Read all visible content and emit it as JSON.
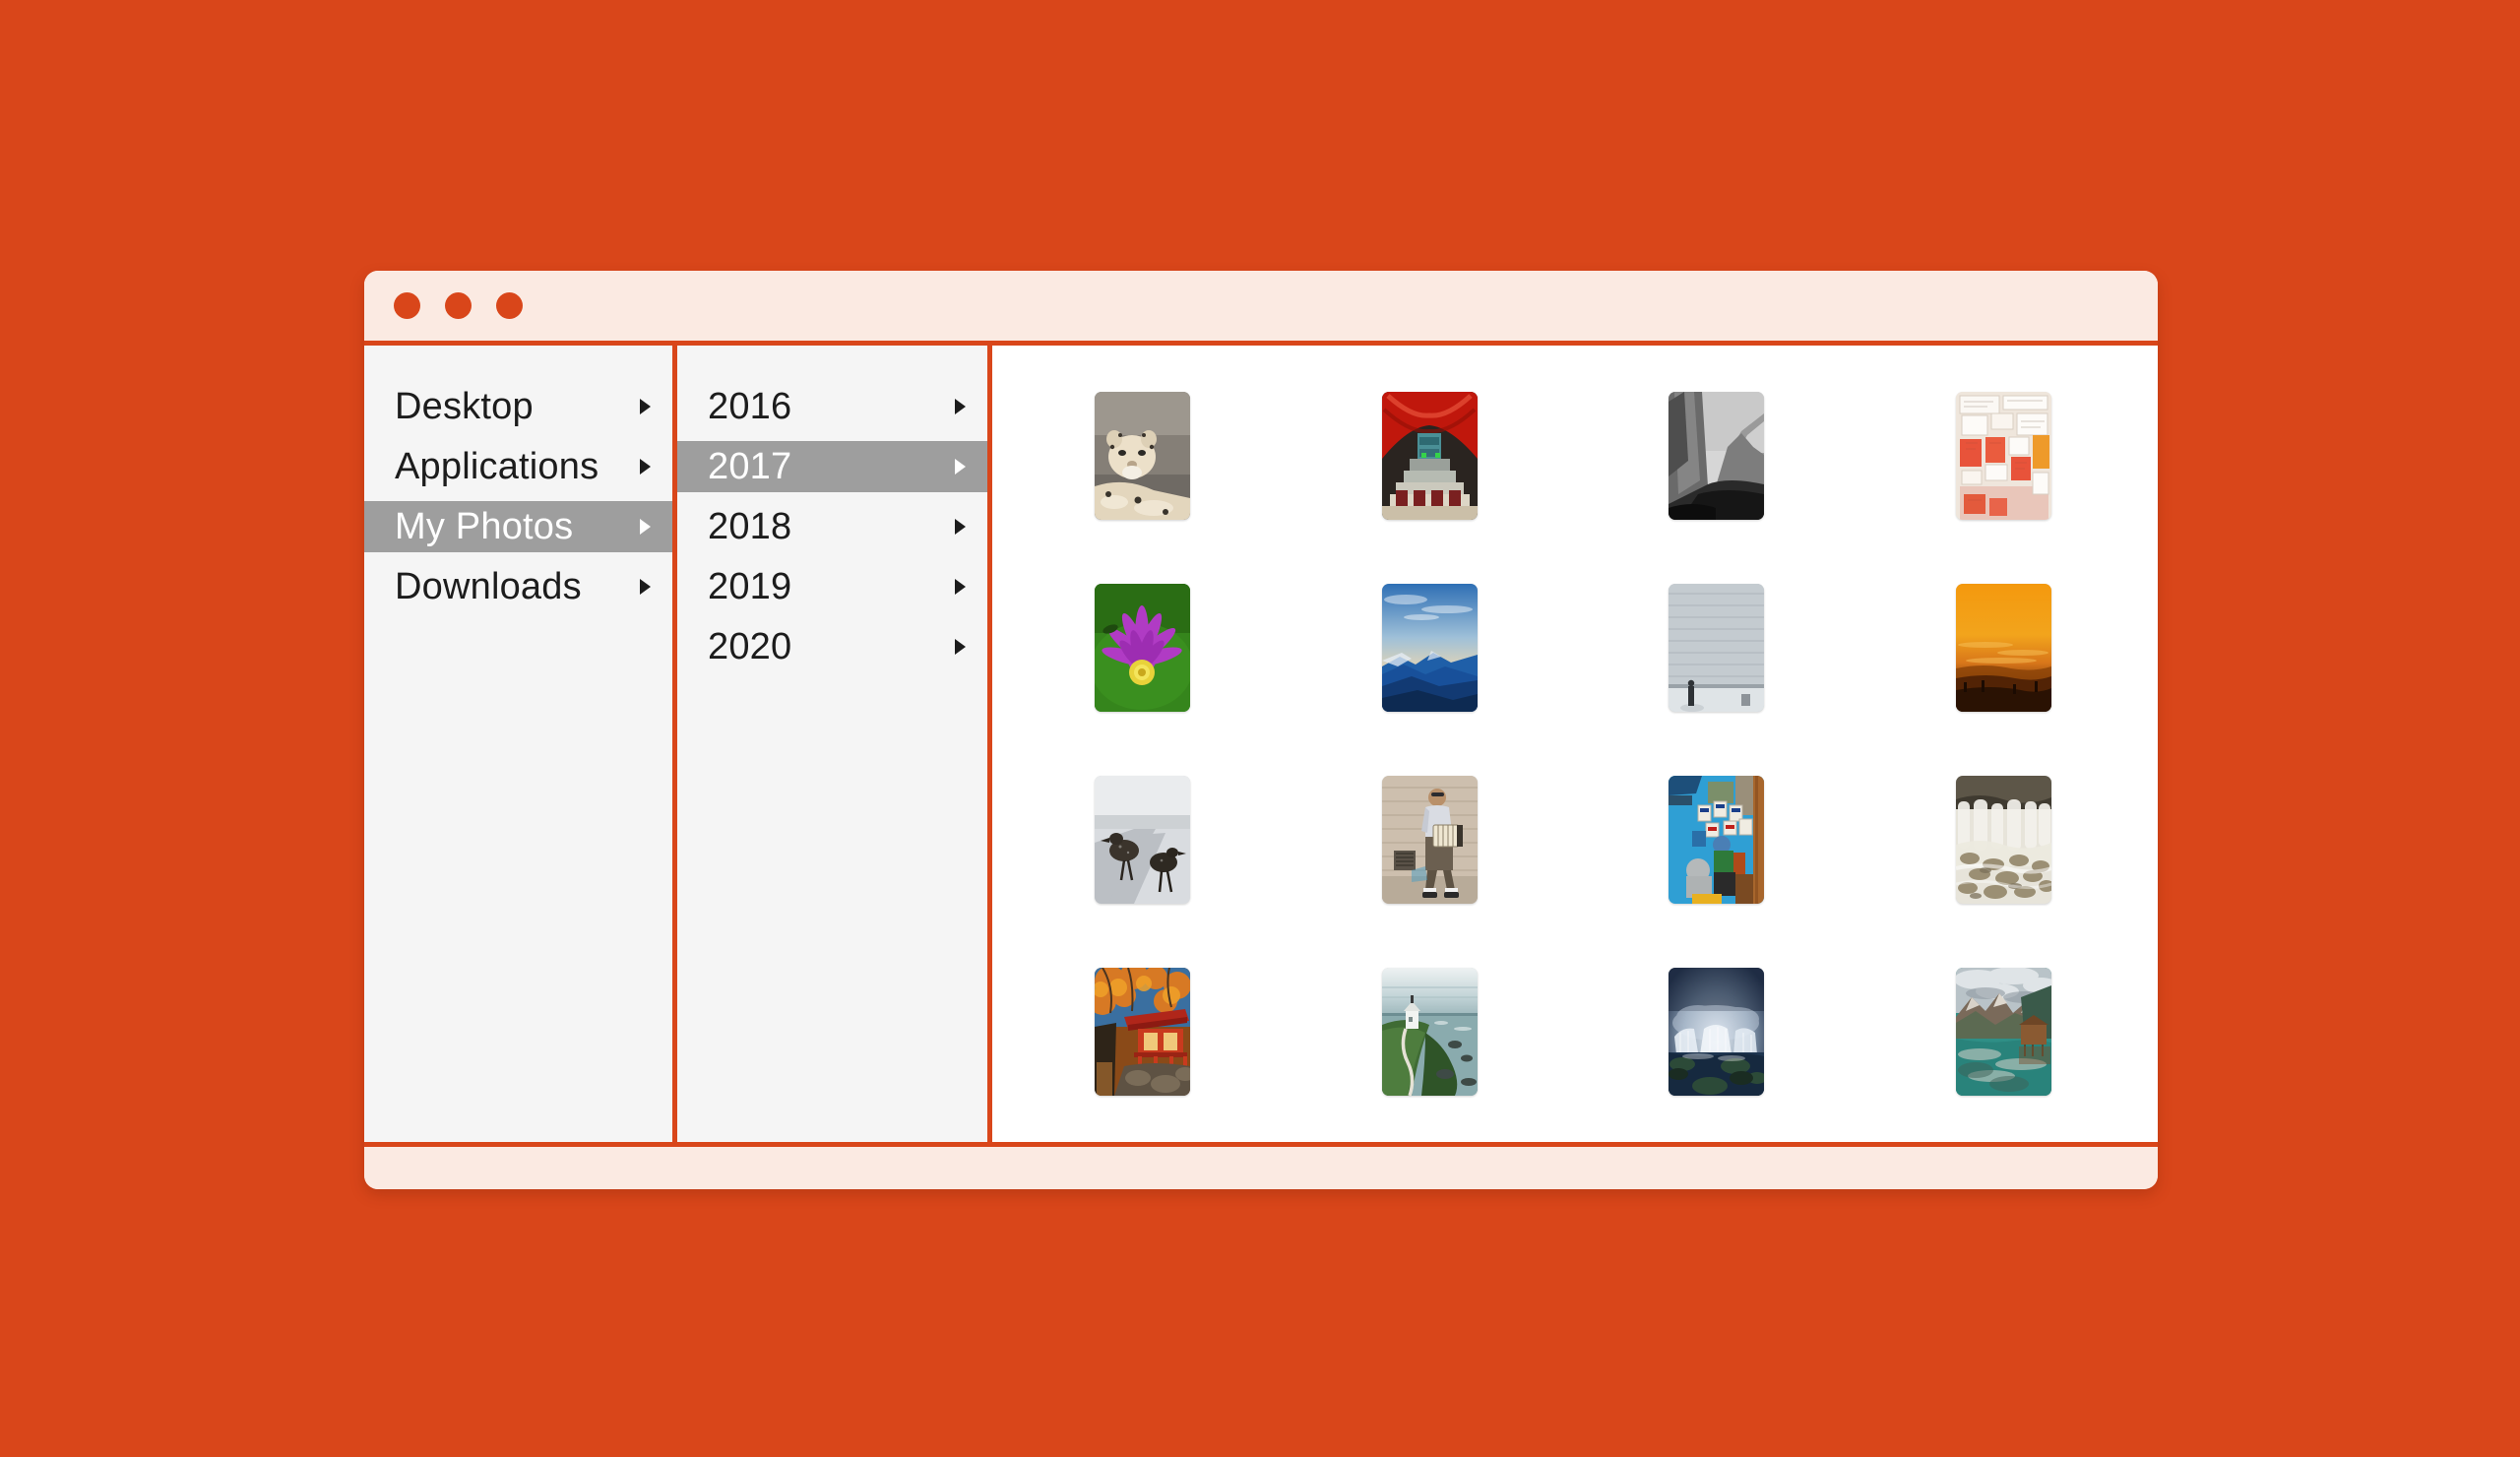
{
  "theme": {
    "desktop_background": "#d9461a",
    "window_chrome": "#fbeae2",
    "accent": "#d9461a",
    "menu_background": "#f5f5f5",
    "selection_background": "#9e9e9e",
    "selection_text": "#ffffff",
    "menu_text": "#1c1c1c",
    "photo_panel_background": "#ffffff"
  },
  "titlebar": {
    "buttons": [
      {
        "name": "close",
        "color": "#d9461a"
      },
      {
        "name": "minimize",
        "color": "#d9461a"
      },
      {
        "name": "maximize",
        "color": "#d9461a"
      }
    ]
  },
  "sidebar": {
    "items": [
      {
        "label": "Desktop",
        "selected": false,
        "has_submenu": true
      },
      {
        "label": "Applications",
        "selected": false,
        "has_submenu": true
      },
      {
        "label": "My Photos",
        "selected": true,
        "has_submenu": true
      },
      {
        "label": "Downloads",
        "selected": false,
        "has_submenu": true
      }
    ]
  },
  "years_column": {
    "items": [
      {
        "label": "2016",
        "selected": false,
        "has_submenu": true
      },
      {
        "label": "2017",
        "selected": true,
        "has_submenu": true
      },
      {
        "label": "2018",
        "selected": false,
        "has_submenu": true
      },
      {
        "label": "2019",
        "selected": false,
        "has_submenu": true
      },
      {
        "label": "2020",
        "selected": false,
        "has_submenu": true
      }
    ]
  },
  "photo_grid": {
    "columns": 4,
    "rows": 4,
    "thumbnails": [
      {
        "subject": "snow-leopard-on-rock",
        "palette": [
          "#8e8a83",
          "#6f6a64",
          "#e8ddc8",
          "#3a342e"
        ]
      },
      {
        "subject": "red-subway-station-stockholm",
        "palette": [
          "#c0170c",
          "#e23a14",
          "#6e5c48",
          "#2a2420"
        ]
      },
      {
        "subject": "black-and-white-yosemite-valley",
        "palette": [
          "#cfcfcf",
          "#8a8a8a",
          "#3a3a3a",
          "#111111"
        ]
      },
      {
        "subject": "wall-of-pasted-paper-notices",
        "palette": [
          "#f3ece4",
          "#e5543a",
          "#e8a33c",
          "#cfc2b4"
        ]
      },
      {
        "subject": "purple-water-lily-flower",
        "palette": [
          "#2f7a17",
          "#b03bc4",
          "#e8d23a",
          "#5aa02a"
        ]
      },
      {
        "subject": "blue-mountain-range-at-dawn",
        "palette": [
          "#1f5fa8",
          "#e6d2ae",
          "#123a73",
          "#0d2a52"
        ]
      },
      {
        "subject": "grey-concrete-wall-with-figure",
        "palette": [
          "#c8ced2",
          "#aeb6bc",
          "#8e979d",
          "#e3e7ea"
        ]
      },
      {
        "subject": "orange-sunset-over-misty-fields",
        "palette": [
          "#f08a10",
          "#f6b232",
          "#7a3a06",
          "#2c1404"
        ]
      },
      {
        "subject": "two-birds-on-sunlit-pavement",
        "palette": [
          "#dfe2e4",
          "#b9bcc0",
          "#3a332c",
          "#8f9499"
        ]
      },
      {
        "subject": "accordion-player-by-brick-wall",
        "palette": [
          "#cdbfae",
          "#e6ddd2",
          "#5b5a63",
          "#6c5a44"
        ]
      },
      {
        "subject": "street-market-stall-vendor",
        "palette": [
          "#2f9fd4",
          "#e8e2d8",
          "#3a7a3a",
          "#8a5a2a"
        ]
      },
      {
        "subject": "waterfall-over-mossy-stones",
        "palette": [
          "#e7e4da",
          "#b7ac96",
          "#6f6550",
          "#f4f2ec"
        ]
      },
      {
        "subject": "japanese-temple-in-autumn-leaves",
        "palette": [
          "#d9571f",
          "#f0952a",
          "#b0261a",
          "#4a3a22"
        ]
      },
      {
        "subject": "white-house-on-coastal-cliff",
        "palette": [
          "#9fb7bc",
          "#cfe0e2",
          "#3f6b34",
          "#f0f3f2"
        ]
      },
      {
        "subject": "godafoss-waterfall-at-dusk",
        "palette": [
          "#cdd8e6",
          "#52637d",
          "#1d2a3c",
          "#7f94ab"
        ]
      },
      {
        "subject": "boathouse-on-alpine-lake",
        "palette": [
          "#2f8f86",
          "#d9d4cc",
          "#7a4a2a",
          "#3a5a4a"
        ]
      }
    ]
  }
}
